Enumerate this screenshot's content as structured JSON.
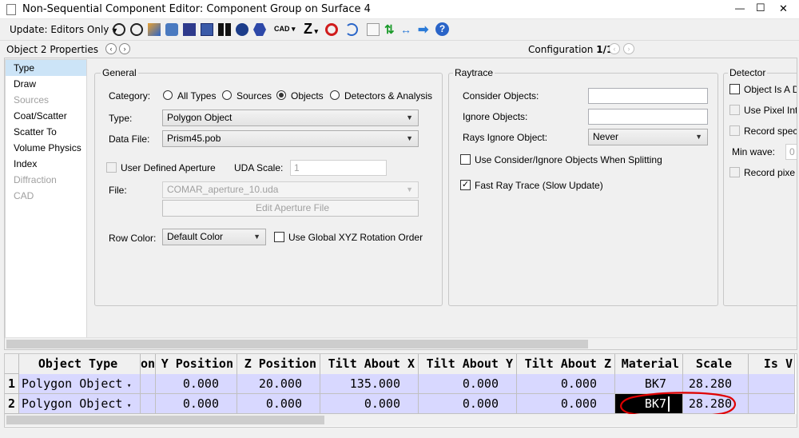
{
  "window": {
    "title": "Non-Sequential Component Editor: Component Group on Surface 4",
    "min": "—",
    "max": "☐",
    "close": "✕"
  },
  "toolbar": {
    "update_label": "Update: Editors Only",
    "cad_label": "CAD",
    "z_label": "Z"
  },
  "props_bar": {
    "title": "Object 2 Properties",
    "configuration": "Configuration",
    "config_value": "1/1"
  },
  "sidebar": {
    "items": [
      {
        "label": "Type"
      },
      {
        "label": "Draw"
      },
      {
        "label": "Sources"
      },
      {
        "label": "Coat/Scatter"
      },
      {
        "label": "Scatter To"
      },
      {
        "label": "Volume Physics"
      },
      {
        "label": "Index"
      },
      {
        "label": "Diffraction"
      },
      {
        "label": "CAD"
      }
    ]
  },
  "general": {
    "legend": "General",
    "category_label": "Category:",
    "cat_all": "All Types",
    "cat_sources": "Sources",
    "cat_objects": "Objects",
    "cat_detectors": "Detectors & Analysis",
    "type_label": "Type:",
    "type_value": "Polygon Object",
    "datafile_label": "Data File:",
    "datafile_value": "Prism45.pob",
    "uda_check": "User Defined Aperture",
    "uda_scale_label": "UDA Scale:",
    "uda_scale_value": "1",
    "file_label": "File:",
    "file_value": "COMAR_aperture_10.uda",
    "edit_aperture": "Edit Aperture File",
    "rowcolor_label": "Row Color:",
    "rowcolor_value": "Default Color",
    "global_xyz": "Use Global XYZ Rotation Order"
  },
  "raytrace": {
    "legend": "Raytrace",
    "consider_label": "Consider Objects:",
    "consider_value": "",
    "ignore_label": "Ignore Objects:",
    "ignore_value": "",
    "rays_ignore_label": "Rays Ignore Object:",
    "rays_ignore_value": "Never",
    "use_consider": "Use Consider/Ignore Objects When Splitting",
    "fast_ray": "Fast Ray Trace (Slow Update)"
  },
  "detector": {
    "legend": "Detector",
    "obj_is": "Object Is A D",
    "use_pixel": "Use Pixel Int",
    "record_spec": "Record spec",
    "min_wave_label": "Min wave:",
    "min_wave_value": "0",
    "record_pixel": "Record pixe"
  },
  "grid": {
    "headers": [
      "Object Type",
      "on",
      "Y Position",
      "Z Position",
      "Tilt About X",
      "Tilt About Y",
      "Tilt About Z",
      "Material",
      "Scale",
      "Is V"
    ],
    "rows": [
      {
        "num": "1",
        "type": "Polygon Object",
        "y": "0.000",
        "z": "20.000",
        "tx": "135.000",
        "ty": "0.000",
        "tz": "0.000",
        "mat": "BK7",
        "scale": "28.280"
      },
      {
        "num": "2",
        "type": "Polygon Object",
        "y": "0.000",
        "z": "0.000",
        "tx": "0.000",
        "ty": "0.000",
        "tz": "0.000",
        "mat": "BK7",
        "scale": "28.280"
      }
    ]
  },
  "colors": {
    "row_bg": "#d8d8ff",
    "selected_cell": "#000000",
    "annotation": "#e00000"
  }
}
